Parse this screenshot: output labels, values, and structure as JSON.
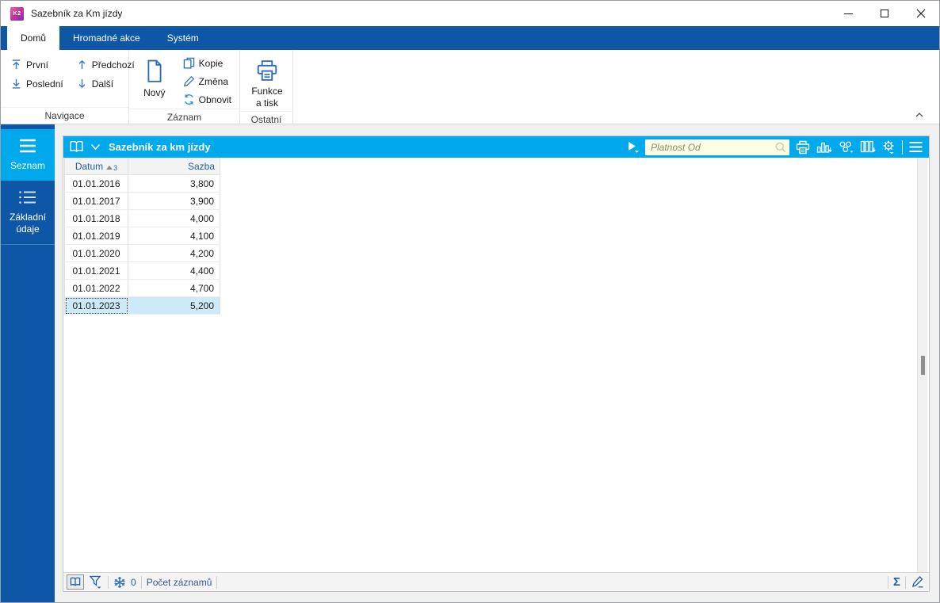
{
  "window": {
    "title": "Sazebník za Km jízdy",
    "logo_text": "K2",
    "controls": [
      "minimize",
      "maximize",
      "close"
    ]
  },
  "ribbon": {
    "tabs": [
      {
        "label": "Domů",
        "active": true
      },
      {
        "label": "Hromadné akce",
        "active": false
      },
      {
        "label": "Systém",
        "active": false
      }
    ],
    "groups": {
      "navigace": {
        "label": "Navigace",
        "prvni": "První",
        "posledni": "Poslední",
        "predchozi": "Předchozí",
        "dalsi": "Další"
      },
      "zaznam": {
        "label": "Záznam",
        "novy": "Nový",
        "kopie": "Kopie",
        "zmena": "Změna",
        "obnovit": "Obnovit"
      },
      "ostatni": {
        "label": "Ostatní",
        "funkce_a_tisk": "Funkce a tisk"
      }
    }
  },
  "sidebar": {
    "items": [
      {
        "label": "Seznam",
        "icon": "menu-icon",
        "active": true
      },
      {
        "label": "Základní údaje",
        "icon": "list-icon",
        "active": false
      }
    ]
  },
  "panel": {
    "title": "Sazebník za km jízdy",
    "search_placeholder": "Platnost Od",
    "toolbar_icons": [
      "book-icon",
      "chevron-down-icon",
      "play-icon",
      "search-icon",
      "printer-icon",
      "chart-icon",
      "cluster-icon",
      "columns-icon",
      "gear-icon",
      "menu-icon"
    ]
  },
  "table": {
    "columns": [
      {
        "label": "Datum",
        "sort": "asc",
        "sort_order": "3"
      },
      {
        "label": "Sazba"
      }
    ],
    "rows": [
      {
        "datum": "01.01.2016",
        "sazba": "3,800"
      },
      {
        "datum": "01.01.2017",
        "sazba": "3,900"
      },
      {
        "datum": "01.01.2018",
        "sazba": "4,000"
      },
      {
        "datum": "01.01.2019",
        "sazba": "4,100"
      },
      {
        "datum": "01.01.2020",
        "sazba": "4,200"
      },
      {
        "datum": "01.01.2021",
        "sazba": "4,400"
      },
      {
        "datum": "01.01.2022",
        "sazba": "4,700"
      },
      {
        "datum": "01.01.2023",
        "sazba": "5,200"
      }
    ],
    "selected_index": 7
  },
  "statusbar": {
    "snowflake_count": "0",
    "record_count_label": "Počet záznamů",
    "icons": [
      "book-icon",
      "filter-icon",
      "snowflake-icon",
      "sigma-icon",
      "edit-icon"
    ]
  },
  "colors": {
    "dark_blue": "#0d57a6",
    "cyan": "#00a9ec",
    "ribbon_icon_blue": "#2f6cb3",
    "selected_row_bg": "#cdeaf9",
    "search_bg": "#fdfde3"
  }
}
